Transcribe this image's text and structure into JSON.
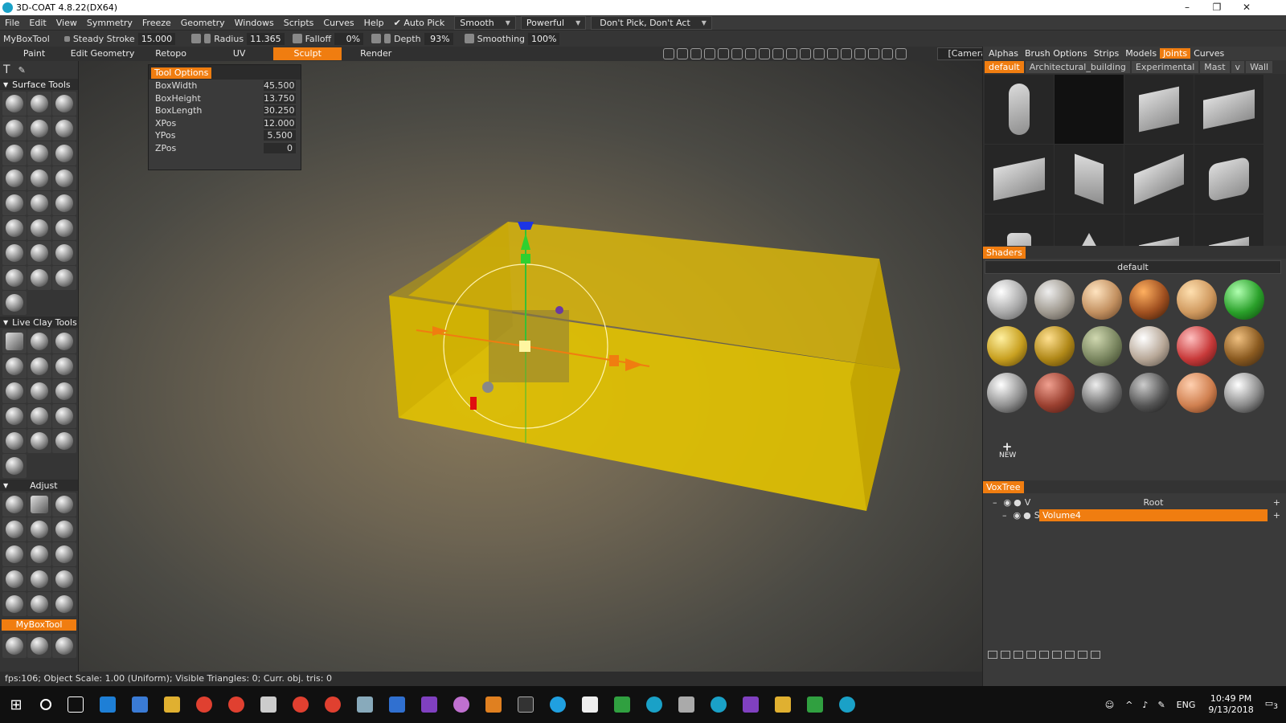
{
  "window": {
    "title": "3D-COAT 4.8.22(DX64)",
    "minimize": "–",
    "maximize": "❐",
    "close": "✕"
  },
  "menu": {
    "items": [
      "File",
      "Edit",
      "View",
      "Symmetry",
      "Freeze",
      "Geometry",
      "Windows",
      "Scripts",
      "Curves",
      "Help"
    ],
    "autopick": "Auto Pick",
    "smooth": "Smooth",
    "powerful": "Powerful",
    "dontpick": "Don't Pick, Don't Act"
  },
  "toolbar": {
    "tool": "MyBoxTool",
    "steady": "Steady Stroke",
    "steady_val": "15.000",
    "radius": "Radius",
    "radius_val": "11.365",
    "falloff": "Falloff",
    "falloff_val": "0%",
    "depth": "Depth",
    "depth_val": "93%",
    "smoothing": "Smoothing",
    "smoothing_val": "100%"
  },
  "rooms": [
    "Paint",
    "Edit Geometry",
    "Retopo",
    "UV",
    "Sculpt",
    "Render"
  ],
  "camera": "[Camera]",
  "left": {
    "surface": "Surface Tools",
    "liveclay": "Live Clay Tools",
    "adjust": "Adjust",
    "mybox": "MyBoxTool"
  },
  "tool_options": {
    "title": "Tool Options",
    "rows": [
      {
        "label": "BoxWidth",
        "value": "45.500"
      },
      {
        "label": "BoxHeight",
        "value": "13.750"
      },
      {
        "label": "BoxLength",
        "value": "30.250"
      },
      {
        "label": "XPos",
        "value": "12.000"
      },
      {
        "label": "YPos",
        "value": "5.500"
      },
      {
        "label": "ZPos",
        "value": "0"
      }
    ]
  },
  "right": {
    "tabs": [
      "Alphas",
      "Brush Options",
      "Strips",
      "Models",
      "Joints",
      "Curves"
    ],
    "subtabs": [
      "default",
      "Architectural_building",
      "Experimental",
      "Mast",
      "v",
      "Wall"
    ],
    "shaders_title": "Shaders",
    "shader_preset": "default",
    "new_label": "NEW",
    "voxtree_title": "VoxTree",
    "root": "Root",
    "volume": "Volume4",
    "root_flag": "V",
    "vol_flag": "S"
  },
  "status": "fps:106;     Object Scale: 1.00 (Uniform); Visible Triangles: 0; Curr. obj. tris: 0",
  "taskbar": {
    "lang": "ENG",
    "time": "10:49 PM",
    "date": "9/13/2018",
    "notif": "3"
  },
  "colors": {
    "accent": "#f07d10",
    "box": "#e3c300"
  }
}
